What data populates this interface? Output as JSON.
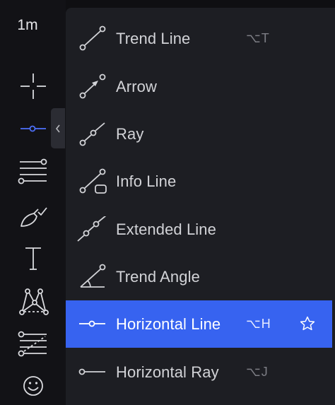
{
  "toolbar": {
    "timeframe": "1m",
    "tools": [
      {
        "name": "crosshair-icon"
      },
      {
        "name": "horizontal-line-tool-icon"
      },
      {
        "name": "fib-retracement-icon"
      },
      {
        "name": "brush-icon"
      },
      {
        "name": "text-icon"
      },
      {
        "name": "pattern-icon"
      },
      {
        "name": "prediction-measurement-icon"
      },
      {
        "name": "emoji-icon"
      }
    ],
    "collapse_icon": "chevron-left-icon"
  },
  "menu": {
    "items": [
      {
        "label": "Trend Line",
        "shortcut": "⌥T",
        "icon": "trend-line-icon"
      },
      {
        "label": "Arrow",
        "shortcut": "",
        "icon": "arrow-icon"
      },
      {
        "label": "Ray",
        "shortcut": "",
        "icon": "ray-icon"
      },
      {
        "label": "Info Line",
        "shortcut": "",
        "icon": "info-line-icon"
      },
      {
        "label": "Extended Line",
        "shortcut": "",
        "icon": "extended-line-icon"
      },
      {
        "label": "Trend Angle",
        "shortcut": "",
        "icon": "trend-angle-icon"
      },
      {
        "label": "Horizontal Line",
        "shortcut": "⌥H",
        "icon": "horizontal-line-icon",
        "active": true,
        "favorite_icon": "star-icon"
      },
      {
        "label": "Horizontal Ray",
        "shortcut": "⌥J",
        "icon": "horizontal-ray-icon"
      }
    ]
  },
  "colors": {
    "accent": "#3763f0",
    "panel": "#1d1e23",
    "toolbar": "#121216",
    "text": "#d2d3d7",
    "active_tool": "#4c6ef5"
  }
}
